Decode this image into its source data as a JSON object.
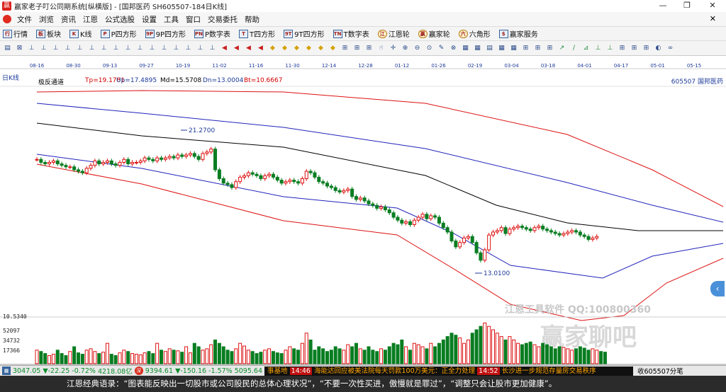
{
  "window": {
    "title": "赢家老子叮公同期系统[纵横版] - [国邦医药  SH605507-184日K线]",
    "controls": {
      "min": "—",
      "max": "❐",
      "close": "✕"
    }
  },
  "menu": [
    "文件",
    "浏览",
    "资讯",
    "江恩",
    "公式选股",
    "设置",
    "工具",
    "窗口",
    "交易委托",
    "帮助"
  ],
  "toolbar1": [
    {
      "icon": "行",
      "label": "行情"
    },
    {
      "icon": "板",
      "label": "板块"
    },
    {
      "icon": "K",
      "label": "K线"
    },
    {
      "icon": "P",
      "label": "P四方形"
    },
    {
      "icon": "9P",
      "label": "9P四方形"
    },
    {
      "icon": "PN",
      "label": "P数字表"
    },
    {
      "icon": "T",
      "label": "T四方形"
    },
    {
      "icon": "9T",
      "label": "9T四方形"
    },
    {
      "icon": "TN",
      "label": "T数字表"
    },
    {
      "icon": "江",
      "label": "江恩轮",
      "round": true
    },
    {
      "icon": "赢",
      "label": "赢家轮",
      "round": true
    },
    {
      "icon": "六",
      "label": "六角形",
      "round": true
    },
    {
      "icon": "$",
      "label": "赢家服务"
    }
  ],
  "toolbar2_icons": [
    "▤",
    "⊠",
    "⊥",
    "⊥",
    "⊥",
    "⊥",
    "⊥",
    "⊥",
    "⊥",
    "⊥",
    "⊥",
    "⊥",
    "⊥",
    "⊥",
    "⊥",
    "⊥",
    "⊥",
    "⊥",
    "◀",
    "◀",
    "◀",
    "◀",
    "◆",
    "◆",
    "◆",
    "◆",
    "◆",
    "◆",
    "⊞",
    "⊞",
    "⊞",
    "☝",
    "✛",
    "⊕",
    "⊖",
    "⊙",
    "✎",
    "⊗",
    "▦",
    "▦",
    "▤",
    "▦",
    "▦",
    "⊞",
    "⊞",
    "⊞",
    "↗",
    "∕",
    "⊿",
    "⊥",
    "⊥",
    "⊞",
    "⊞",
    "⊞",
    "◐",
    "∞"
  ],
  "chart": {
    "period_label": "日K线",
    "indicator_name": "极反通道",
    "tp": "Tp=19.1781",
    "up": "Up=17.4895",
    "md": "Md=15.5708",
    "dn": "Dn=13.0004",
    "bt": "Bt=10.6667",
    "code_label": "605507 国邦医药",
    "high_mark": "21.2700",
    "low_mark": "13.0100",
    "date_ticks": [
      "08-16",
      "08-30",
      "09-13",
      "09-27",
      "10-19",
      "11-02",
      "11-16",
      "11-30",
      "12-14",
      "12-28",
      "01-12",
      "01-26",
      "02-19",
      "03-04",
      "03-18",
      "04-01",
      "04-17",
      "05-01",
      "05-15"
    ],
    "vol_labels": [
      "10.5340",
      "52097",
      "34732",
      "17366"
    ],
    "watermark_text": "江恩工具软件 QQ:100800360",
    "watermark_brand": "赢家聊吧",
    "chart_data": {
      "type": "candlestick",
      "ylim": [
        12.0,
        22.5
      ],
      "close": [
        20.1,
        19.9,
        19.8,
        19.9,
        20.0,
        19.8,
        19.7,
        19.6,
        19.6,
        19.4,
        19.3,
        19.2,
        19.5,
        19.7,
        20.0,
        19.8,
        19.9,
        20.0,
        19.8,
        19.7,
        19.9,
        20.1,
        19.8,
        19.9,
        19.9,
        20.0,
        20.2,
        20.1,
        20.0,
        20.2,
        20.1,
        20.2,
        20.3,
        20.2,
        20.4,
        20.3,
        20.4,
        20.5,
        20.3,
        20.1,
        20.5,
        20.6,
        20.8,
        19.4,
        18.8,
        18.5,
        18.4,
        18.2,
        18.6,
        18.9,
        19.0,
        19.2,
        19.1,
        19.0,
        18.8,
        19.0,
        19.1,
        18.9,
        18.7,
        18.5,
        18.6,
        18.7,
        18.6,
        18.5,
        18.8,
        19.3,
        19.2,
        18.9,
        18.6,
        18.5,
        18.3,
        18.2,
        18.0,
        17.9,
        18.0,
        18.1,
        17.6,
        17.4,
        17.5,
        17.3,
        17.1,
        17.0,
        16.8,
        16.9,
        16.7,
        16.5,
        16.2,
        16.0,
        15.8,
        15.9,
        15.7,
        16.0,
        16.2,
        16.4,
        16.1,
        16.3,
        16.2,
        15.8,
        15.5,
        15.2,
        14.6,
        14.2,
        14.5,
        14.8,
        14.9,
        14.5,
        13.8,
        13.3,
        14.0,
        15.0,
        15.2,
        15.3,
        15.5,
        15.1,
        15.4,
        15.5,
        15.6,
        15.5,
        15.4,
        15.3,
        15.5,
        15.6,
        15.4,
        15.3,
        15.2,
        15.1,
        15.0,
        15.1,
        15.2,
        15.3,
        15.2,
        15.0,
        14.9,
        14.7,
        14.8,
        14.9
      ],
      "volume": [
        0.2,
        0.18,
        0.15,
        0.12,
        0.14,
        0.2,
        0.15,
        0.12,
        0.18,
        0.25,
        0.16,
        0.14,
        0.2,
        0.22,
        0.18,
        0.15,
        0.17,
        0.3,
        0.14,
        0.12,
        0.16,
        0.2,
        0.18,
        0.15,
        0.14,
        0.13,
        0.16,
        0.18,
        0.15,
        0.3,
        0.2,
        0.18,
        0.22,
        0.2,
        0.19,
        0.17,
        0.25,
        0.16,
        0.3,
        0.25,
        0.2,
        0.22,
        0.28,
        0.35,
        0.3,
        0.25,
        0.2,
        0.18,
        0.22,
        0.3,
        0.26,
        0.2,
        0.18,
        0.15,
        0.17,
        0.2,
        0.22,
        0.18,
        0.16,
        0.15,
        0.2,
        0.25,
        0.22,
        0.2,
        0.3,
        0.45,
        0.35,
        0.2,
        0.25,
        0.22,
        0.18,
        0.2,
        0.25,
        0.22,
        0.2,
        0.28,
        0.25,
        0.3,
        0.22,
        0.2,
        0.25,
        0.2,
        0.18,
        0.22,
        0.2,
        0.25,
        0.3,
        0.28,
        0.35,
        0.25,
        0.2,
        0.3,
        0.28,
        0.25,
        0.22,
        0.3,
        0.25,
        0.3,
        0.35,
        0.4,
        0.45,
        0.42,
        0.38,
        0.3,
        0.35,
        0.45,
        0.5,
        0.55,
        0.6,
        0.55,
        0.5,
        0.45,
        0.4,
        0.35,
        0.4,
        0.35,
        0.3,
        0.28,
        0.3,
        0.32,
        0.28,
        0.25,
        0.3,
        0.28,
        0.25,
        0.22,
        0.25,
        0.24,
        0.22,
        0.2,
        0.22,
        0.25,
        0.23,
        0.2,
        0.22,
        0.2,
        0.18,
        0.17
      ]
    }
  },
  "taskbar": {
    "sh_index": "3047.05",
    "sh_change": "▼-22.25",
    "sh_pct": "-0.72%",
    "sh_amount": "4218.08亿",
    "sz_index": "9394.61",
    "sz_change": "▼-150.16",
    "sz_pct": "-1.57%",
    "sz_amount": "5095.64",
    "news_prefix": "事基地",
    "news_time1": "14:46",
    "news1": "海能达回应被美法院每天罚款100万美元：正全力处理",
    "news_time2": "14:52",
    "news2": "长沙进一步规范存量房交易秩序",
    "right_label": "收605507分笔"
  },
  "quote": "江恩经典语录：“图表能反映出一切股市或公司股民的总体心理状况”，“不要一次性买进，傲慢就是罪过”，“调整只会让股市更加健康”。"
}
